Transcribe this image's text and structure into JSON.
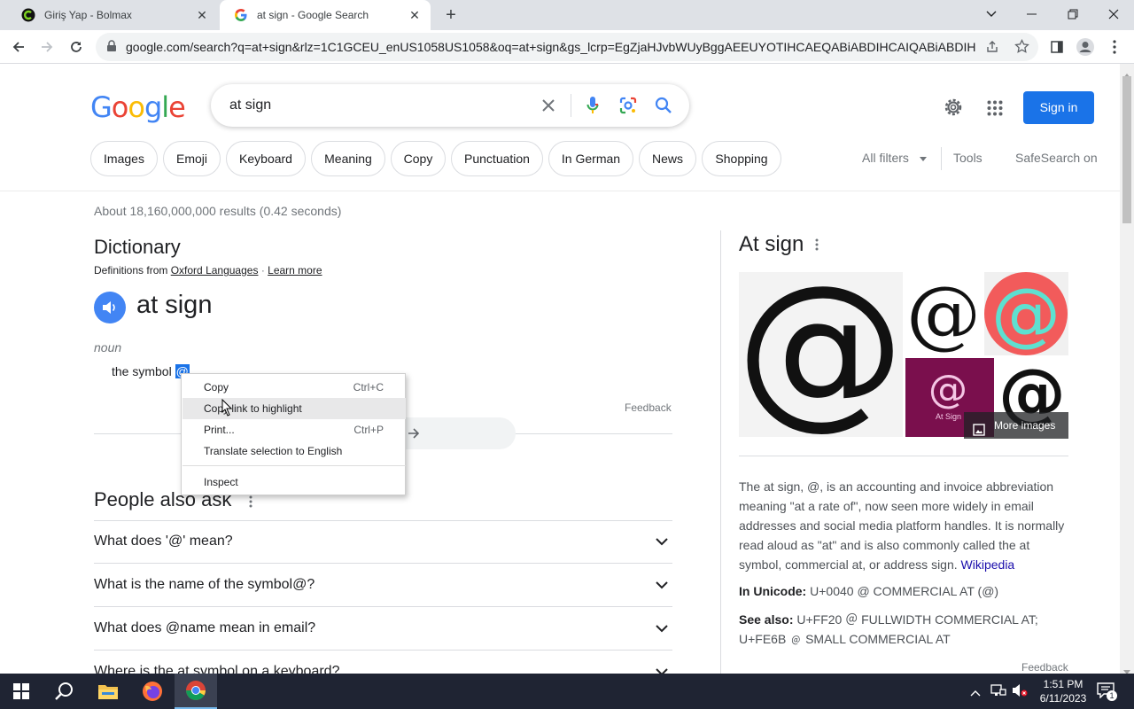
{
  "browser": {
    "tabs": [
      {
        "title": "Giriş Yap - Bolmax"
      },
      {
        "title": "at sign - Google Search"
      }
    ],
    "url": "google.com/search?q=at+sign&rlz=1C1GCEU_enUS1058US1058&oq=at+sign&gs_lcrp=EgZjaHJvbWUyBggAEEUYOTIHCAEQABiABDIHCAIQABiABDIHCA..."
  },
  "search": {
    "logo": "Google",
    "query": "at sign",
    "sign_in": "Sign in",
    "chips": [
      "Images",
      "Emoji",
      "Keyboard",
      "Meaning",
      "Copy",
      "Punctuation",
      "In German",
      "News",
      "Shopping"
    ],
    "all_filters": "All filters",
    "tools": "Tools",
    "safesearch": "SafeSearch on",
    "result_stats": "About 18,160,000,000 results (0.42 seconds)"
  },
  "dictionary": {
    "heading": "Dictionary",
    "definitions_from": "Definitions from",
    "oxford": "Oxford Languages",
    "sep": "·",
    "learn_more": "Learn more",
    "word": "at sign",
    "pos": "noun",
    "definition": "the symbol",
    "symbol": "@",
    "feedback": "Feedback"
  },
  "context_menu": {
    "items": [
      {
        "label": "Copy",
        "shortcut": "Ctrl+C"
      },
      {
        "label": "Copy link to highlight",
        "shortcut": ""
      },
      {
        "label": "Print...",
        "shortcut": "Ctrl+P"
      },
      {
        "label": "Translate selection to English",
        "shortcut": ""
      },
      {
        "label": "Inspect",
        "shortcut": ""
      }
    ]
  },
  "people_also_ask": {
    "heading": "People also ask",
    "questions": [
      "What does '@' mean?",
      "What is the name of the symbol@?",
      "What does @name mean in email?",
      "Where is the at symbol on a keyboard?"
    ]
  },
  "knowledge_panel": {
    "title": "At sign",
    "tile_label": "At Sign",
    "more_images": "More images",
    "description": "The at sign, @, is an accounting and invoice abbreviation meaning \"at a rate of\", now seen more widely in email addresses and social media platform handles. It is normally read aloud as \"at\" and is also commonly called the at symbol, commercial at, or address sign.",
    "wikipedia": "Wikipedia",
    "unicode_label": "In Unicode:",
    "unicode_value": "U+0040 @ COMMERCIAL AT (@)",
    "see_also_label": "See also:",
    "see_also_value_1": "U+FF20 ＠ FULLWIDTH COMMERCIAL AT;",
    "see_also_value_2": "U+FE6B ﹫ SMALL COMMERCIAL AT",
    "feedback": "Feedback"
  },
  "taskbar": {
    "time": "1:51 PM",
    "date": "6/11/2023",
    "notification_count": "1"
  },
  "colors": {
    "google_blue": "#1a73e8",
    "link": "#1a0dab",
    "taskbar": "#1f2433",
    "tab_strip": "#dee1e6"
  }
}
